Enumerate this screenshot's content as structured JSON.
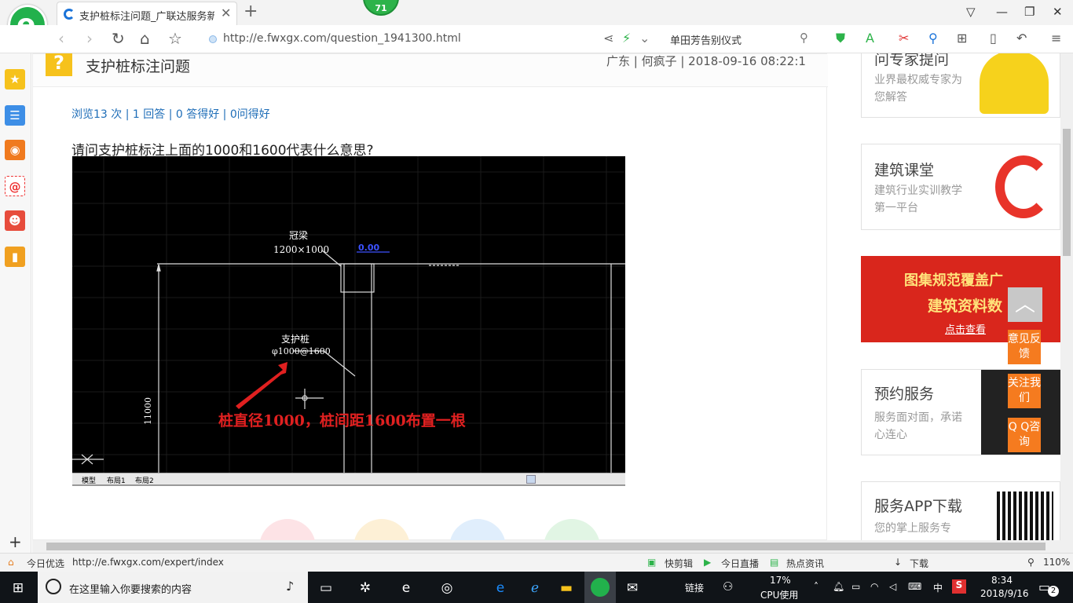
{
  "browser": {
    "tab_title": "支护桩标注问题_广联达服务新干",
    "badge_count": "71",
    "url": "http://e.fwxgx.com/question_1941300.html",
    "search_text": "单田芳告别仪式"
  },
  "question": {
    "title": "支护桩标注问题",
    "meta": "广东 | 何疯子 | 2018-09-16 08:22:1",
    "stats": "浏览13 次 | 1 回答 | 0 答得好 | 0问得好",
    "body": "请问支护桩标注上面的1000和1600代表什么意思?"
  },
  "cad": {
    "label_beam": "冠梁",
    "label_beam_size": "1200×1000",
    "label_elev": "0.00",
    "label_pile": "支护桩",
    "label_pile_spec": "φ1000@1600",
    "label_height": "11000",
    "annotation": "桩直径1000，桩间距1600布置一根",
    "tabs": [
      "模型",
      "布局1",
      "布局2"
    ]
  },
  "right_cards": [
    {
      "title": "问专家提问",
      "desc": "业界最权威专家为您解答"
    },
    {
      "title": "建筑课堂",
      "desc": "建筑行业实训教学第一平台"
    },
    {
      "banner_line1": "图集规范覆盖广",
      "banner_line2": "建筑资料数",
      "banner_btn": "点击查看"
    },
    {
      "title": "预约服务",
      "desc": "服务面对面，承诺心连心"
    },
    {
      "title": "服务APP下载",
      "desc": "您的掌上服务专"
    }
  ],
  "float_buttons": [
    "意见反馈",
    "关注我们",
    "Q Q咨询"
  ],
  "statusbar": {
    "today": "今日优选",
    "link_url": "http://e.fwxgx.com/expert/index",
    "items": [
      "快剪辑",
      "今日直播",
      "热点资讯",
      "下载"
    ],
    "zoom": "110%"
  },
  "taskbar": {
    "search_placeholder": "在这里输入你要搜索的内容",
    "link_label": "链接",
    "cpu_percent": "17%",
    "cpu_label": "CPU使用",
    "ime": "中",
    "time": "8:34",
    "date": "2018/9/16",
    "notifications": "2"
  },
  "colors": {
    "link_blue": "#1f6eb8",
    "accent_orange": "#f57b1f",
    "browser_green": "#22b14c",
    "question_yellow": "#f6c21c",
    "cad_red": "#e02020"
  }
}
